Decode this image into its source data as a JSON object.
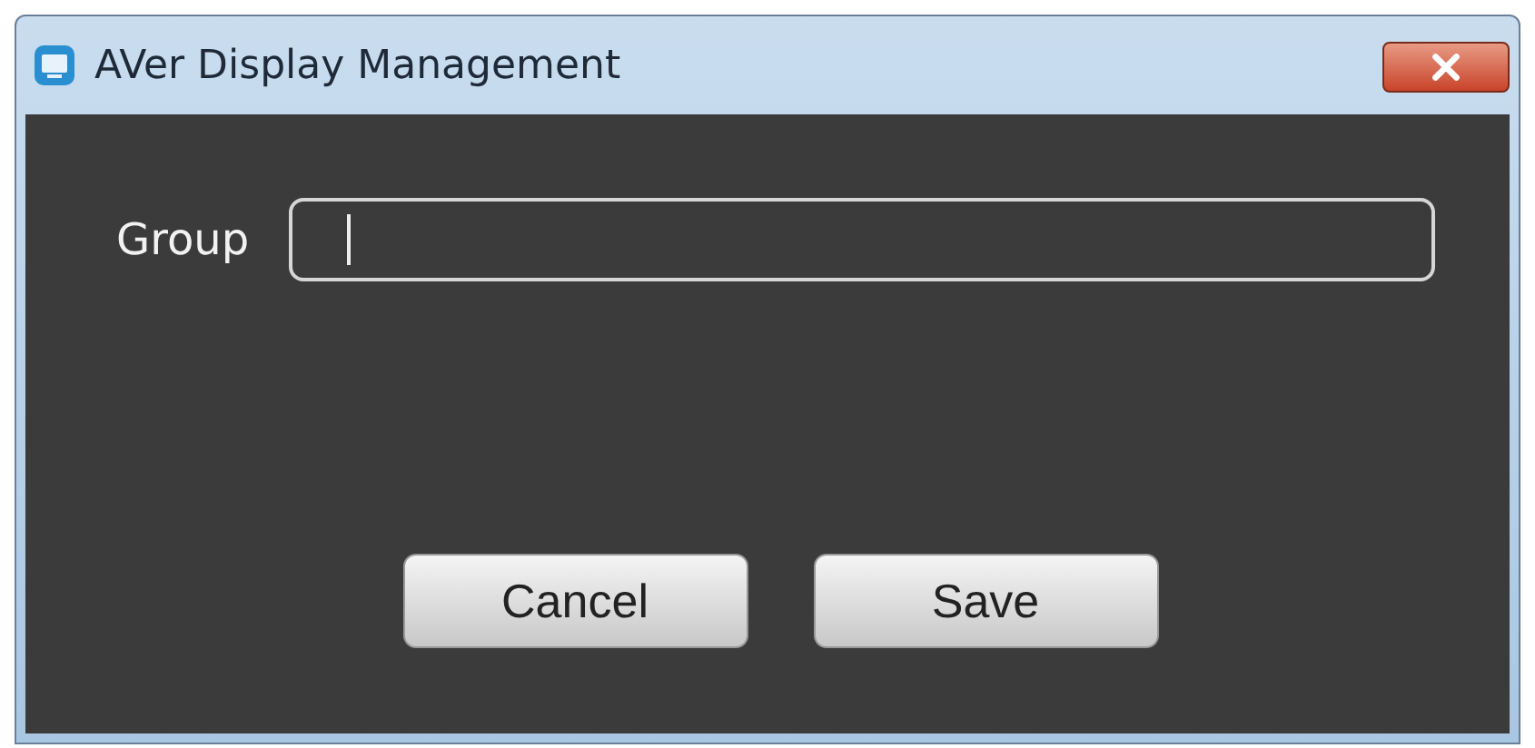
{
  "window": {
    "title": "AVer Display Management"
  },
  "form": {
    "label": "Group"
  },
  "buttons": [
    "Cancel",
    "Save"
  ]
}
